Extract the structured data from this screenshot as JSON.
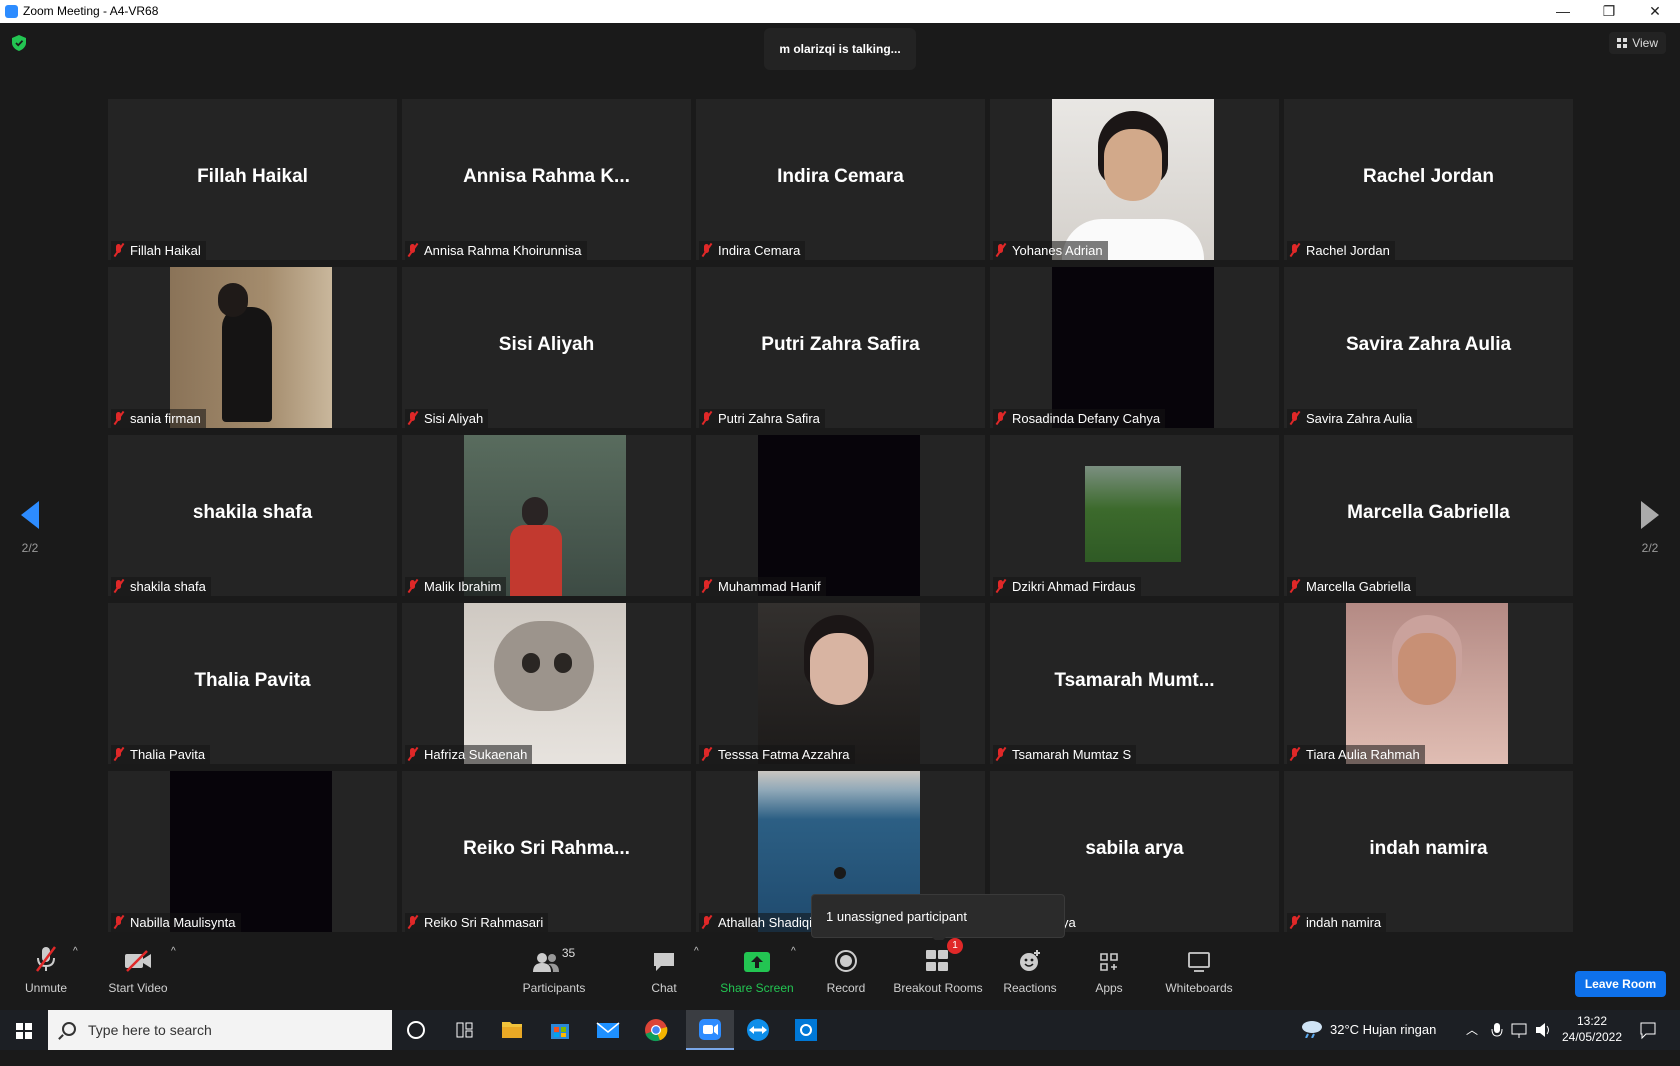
{
  "window": {
    "title": "Zoom Meeting - A4-VR68",
    "minimize": "—",
    "restore": "❐",
    "close": "✕"
  },
  "meeting": {
    "talking": "m olarizqi is talking...",
    "view_label": "View",
    "page_indicator_left": "2/2",
    "page_indicator_right": "2/2",
    "tooltip": "1 unassigned participant"
  },
  "tiles": [
    {
      "big": "Fillah Haikal",
      "label": "Fillah Haikal",
      "video": ""
    },
    {
      "big": "Annisa  Rahma  K...",
      "label": "Annisa Rahma Khoirunnisa",
      "video": ""
    },
    {
      "big": "Indira Cemara",
      "label": "Indira Cemara",
      "video": ""
    },
    {
      "big": "",
      "label": "Yohanes Adrian",
      "video": "portrait-light"
    },
    {
      "big": "Rachel Jordan",
      "label": "Rachel Jordan",
      "video": ""
    },
    {
      "big": "",
      "label": "sania firman",
      "video": "mirror-selfie"
    },
    {
      "big": "Sisi Aliyah",
      "label": "Sisi Aliyah",
      "video": ""
    },
    {
      "big": "Putri Zahra Safira",
      "label": "Putri Zahra Safira",
      "video": ""
    },
    {
      "big": "",
      "label": "Rosadinda Defany Cahya",
      "video": "black"
    },
    {
      "big": "Savira Zahra Aulia",
      "label": "Savira Zahra Aulia",
      "video": ""
    },
    {
      "big": "shakila shafa",
      "label": "shakila shafa",
      "video": ""
    },
    {
      "big": "",
      "label": "Malik Ibrahim",
      "video": "forest-person"
    },
    {
      "big": "",
      "label": "Muhammad Hanif",
      "video": "black"
    },
    {
      "big": "",
      "label": "Dzikri Ahmad Firdaus",
      "video": "small-green"
    },
    {
      "big": "Marcella Gabriella",
      "label": "Marcella Gabriella",
      "video": ""
    },
    {
      "big": "Thalia Pavita",
      "label": "Thalia Pavita",
      "video": ""
    },
    {
      "big": "",
      "label": "Hafriza Sukaenah",
      "video": "cat"
    },
    {
      "big": "",
      "label": "Tesssa Fatma Azzahra",
      "video": "face-dark"
    },
    {
      "big": "Tsamarah  Mumt...",
      "label": "Tsamarah Mumtaz S",
      "video": ""
    },
    {
      "big": "",
      "label": "Tiara Aulia Rahmah",
      "video": "face-hijab"
    },
    {
      "big": "",
      "label": "Nabilla Maulisynta",
      "video": "black"
    },
    {
      "big": "Reiko  Sri  Rahma...",
      "label": "Reiko Sri Rahmasari",
      "video": ""
    },
    {
      "big": "",
      "label": "Athallah Shadiqi",
      "video": "sea"
    },
    {
      "big": "sabila arya",
      "label": "",
      "label_tail": "ya",
      "video": ""
    },
    {
      "big": "indah namira",
      "label": "indah namira",
      "video": ""
    }
  ],
  "toolbar": {
    "unmute": "Unmute",
    "start_video": "Start Video",
    "participants": "Participants",
    "participants_count": "35",
    "chat": "Chat",
    "share_screen": "Share Screen",
    "record": "Record",
    "breakout_rooms": "Breakout Rooms",
    "breakout_badge": "1",
    "reactions": "Reactions",
    "apps": "Apps",
    "whiteboards": "Whiteboards",
    "leave_room": "Leave Room",
    "caret": "^"
  },
  "taskbar": {
    "search_placeholder": "Type here to search",
    "weather": "32°C  Hujan ringan",
    "time": "13:22",
    "date": "24/05/2022"
  },
  "colors": {
    "accent": "#0e71eb",
    "share": "#23c552",
    "muted": "#e02828"
  }
}
